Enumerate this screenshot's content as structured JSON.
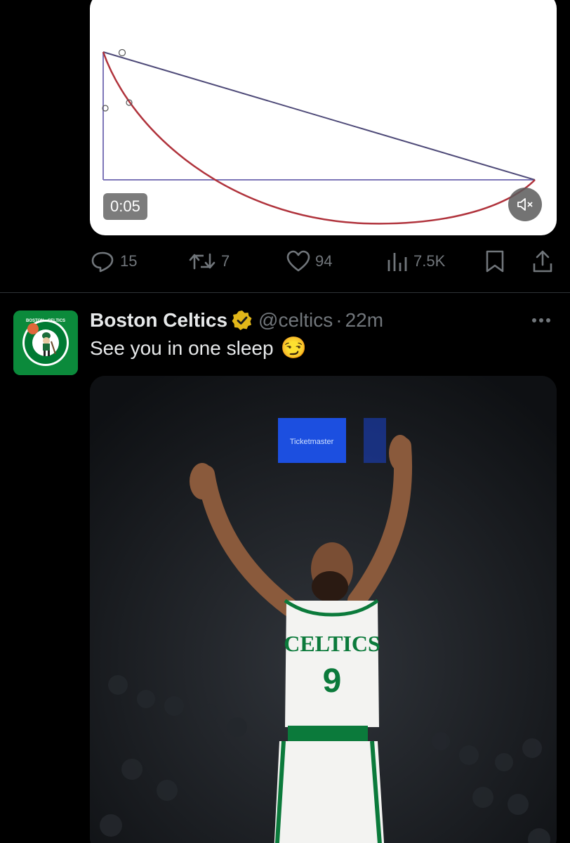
{
  "video_tweet": {
    "video": {
      "timestamp": "0:05",
      "muted": true
    },
    "actions": {
      "replies": "15",
      "reposts": "7",
      "likes": "94",
      "views": "7.5K"
    }
  },
  "tweet": {
    "display_name": "Boston Celtics",
    "verified": true,
    "handle": "@celtics",
    "separator": "·",
    "age": "22m",
    "text": "See you in one sleep",
    "emoji": "😏",
    "photo": {
      "arena_sign": "Ticketmaster",
      "jersey_team": "CELTICS",
      "jersey_number": "9"
    }
  },
  "colors": {
    "background": "#000000",
    "text_primary": "#e7e9ea",
    "text_secondary": "#71767b",
    "divider": "#2f3336",
    "verified_gold": "#e2b719",
    "celtics_green": "#007a33"
  }
}
